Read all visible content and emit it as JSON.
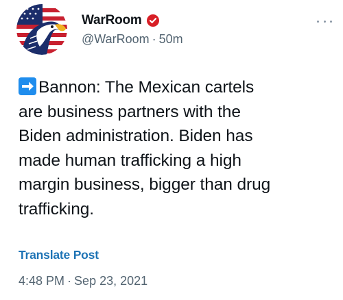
{
  "author": {
    "display_name": "WarRoom",
    "handle": "@WarRoom",
    "relative_time": "50m",
    "separator": "·",
    "verified": true,
    "avatar_icon": "eagle-flag-avatar-icon"
  },
  "post": {
    "lead_icon": "right-arrow-emoji-icon",
    "text": "Bannon: The Mexican cartels\nare business partners with the\nBiden administration. Biden has\nmade human trafficking a high\nmargin business, bigger than drug\ntrafficking."
  },
  "actions": {
    "translate_label": "Translate Post",
    "more_icon": "more-options-icon"
  },
  "meta": {
    "time": "4:48 PM",
    "separator": "·",
    "date": "Sep 23, 2021"
  },
  "colors": {
    "text": "#0f1419",
    "secondary": "#536471",
    "link": "#1d73b5",
    "verified": "#d81f26",
    "emoji_blue": "#1f8ded"
  }
}
